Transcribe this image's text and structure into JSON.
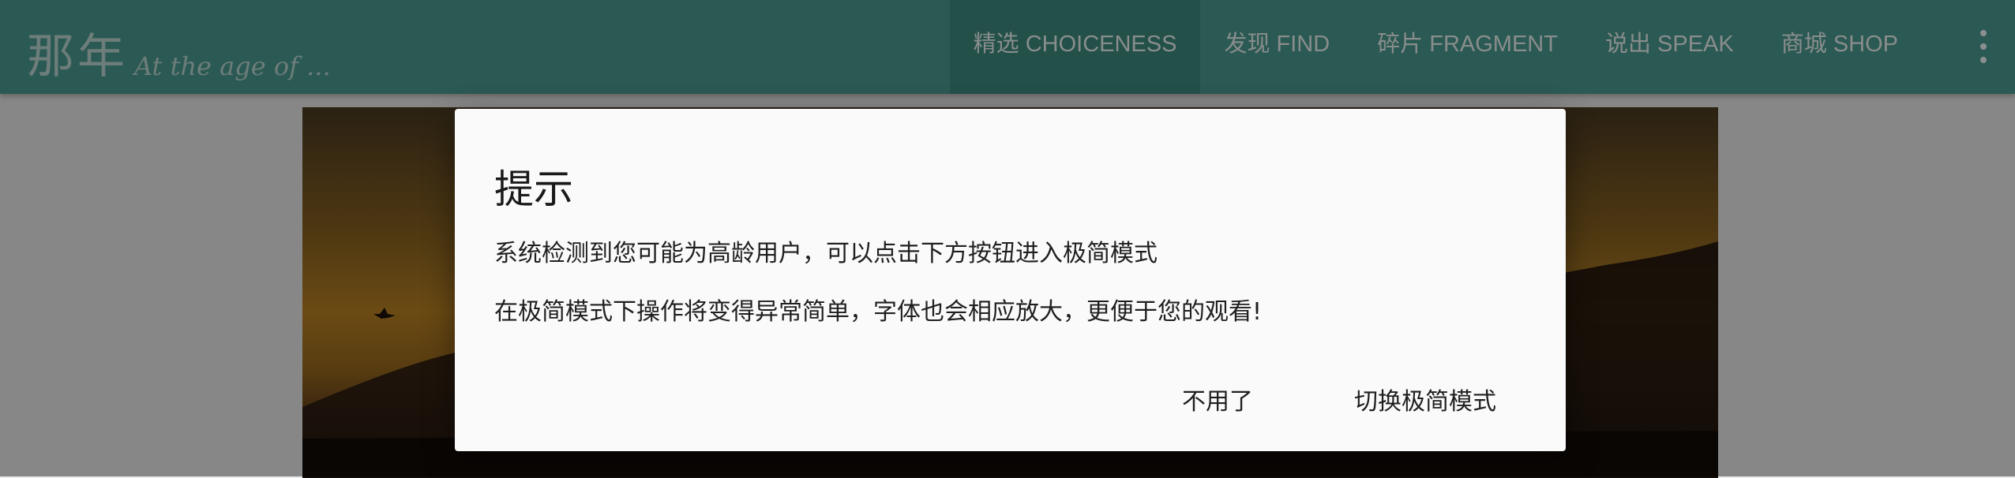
{
  "header": {
    "logo_cn": "那年",
    "logo_en": "At the age of ...",
    "nav": [
      {
        "label": "精选 CHOICENESS",
        "active": true
      },
      {
        "label": "发现 FIND"
      },
      {
        "label": "碎片 FRAGMENT"
      },
      {
        "label": "说出 SPEAK"
      },
      {
        "label": "商城 SHOP"
      }
    ],
    "more_icon": "more-vertical-icon"
  },
  "dialog": {
    "title": "提示",
    "line1": "系统检测到您可能为高龄用户，可以点击下方按钮进入极简模式",
    "line2": "在极简模式下操作将变得异常简单，字体也会相应放大，更便于您的观看!",
    "cancel_label": "不用了",
    "confirm_label": "切换极简模式"
  },
  "colors": {
    "header_bg": "#4a9a8f",
    "overlay": "rgba(0,0,0,0.42)",
    "dialog_bg": "#fafafa"
  }
}
